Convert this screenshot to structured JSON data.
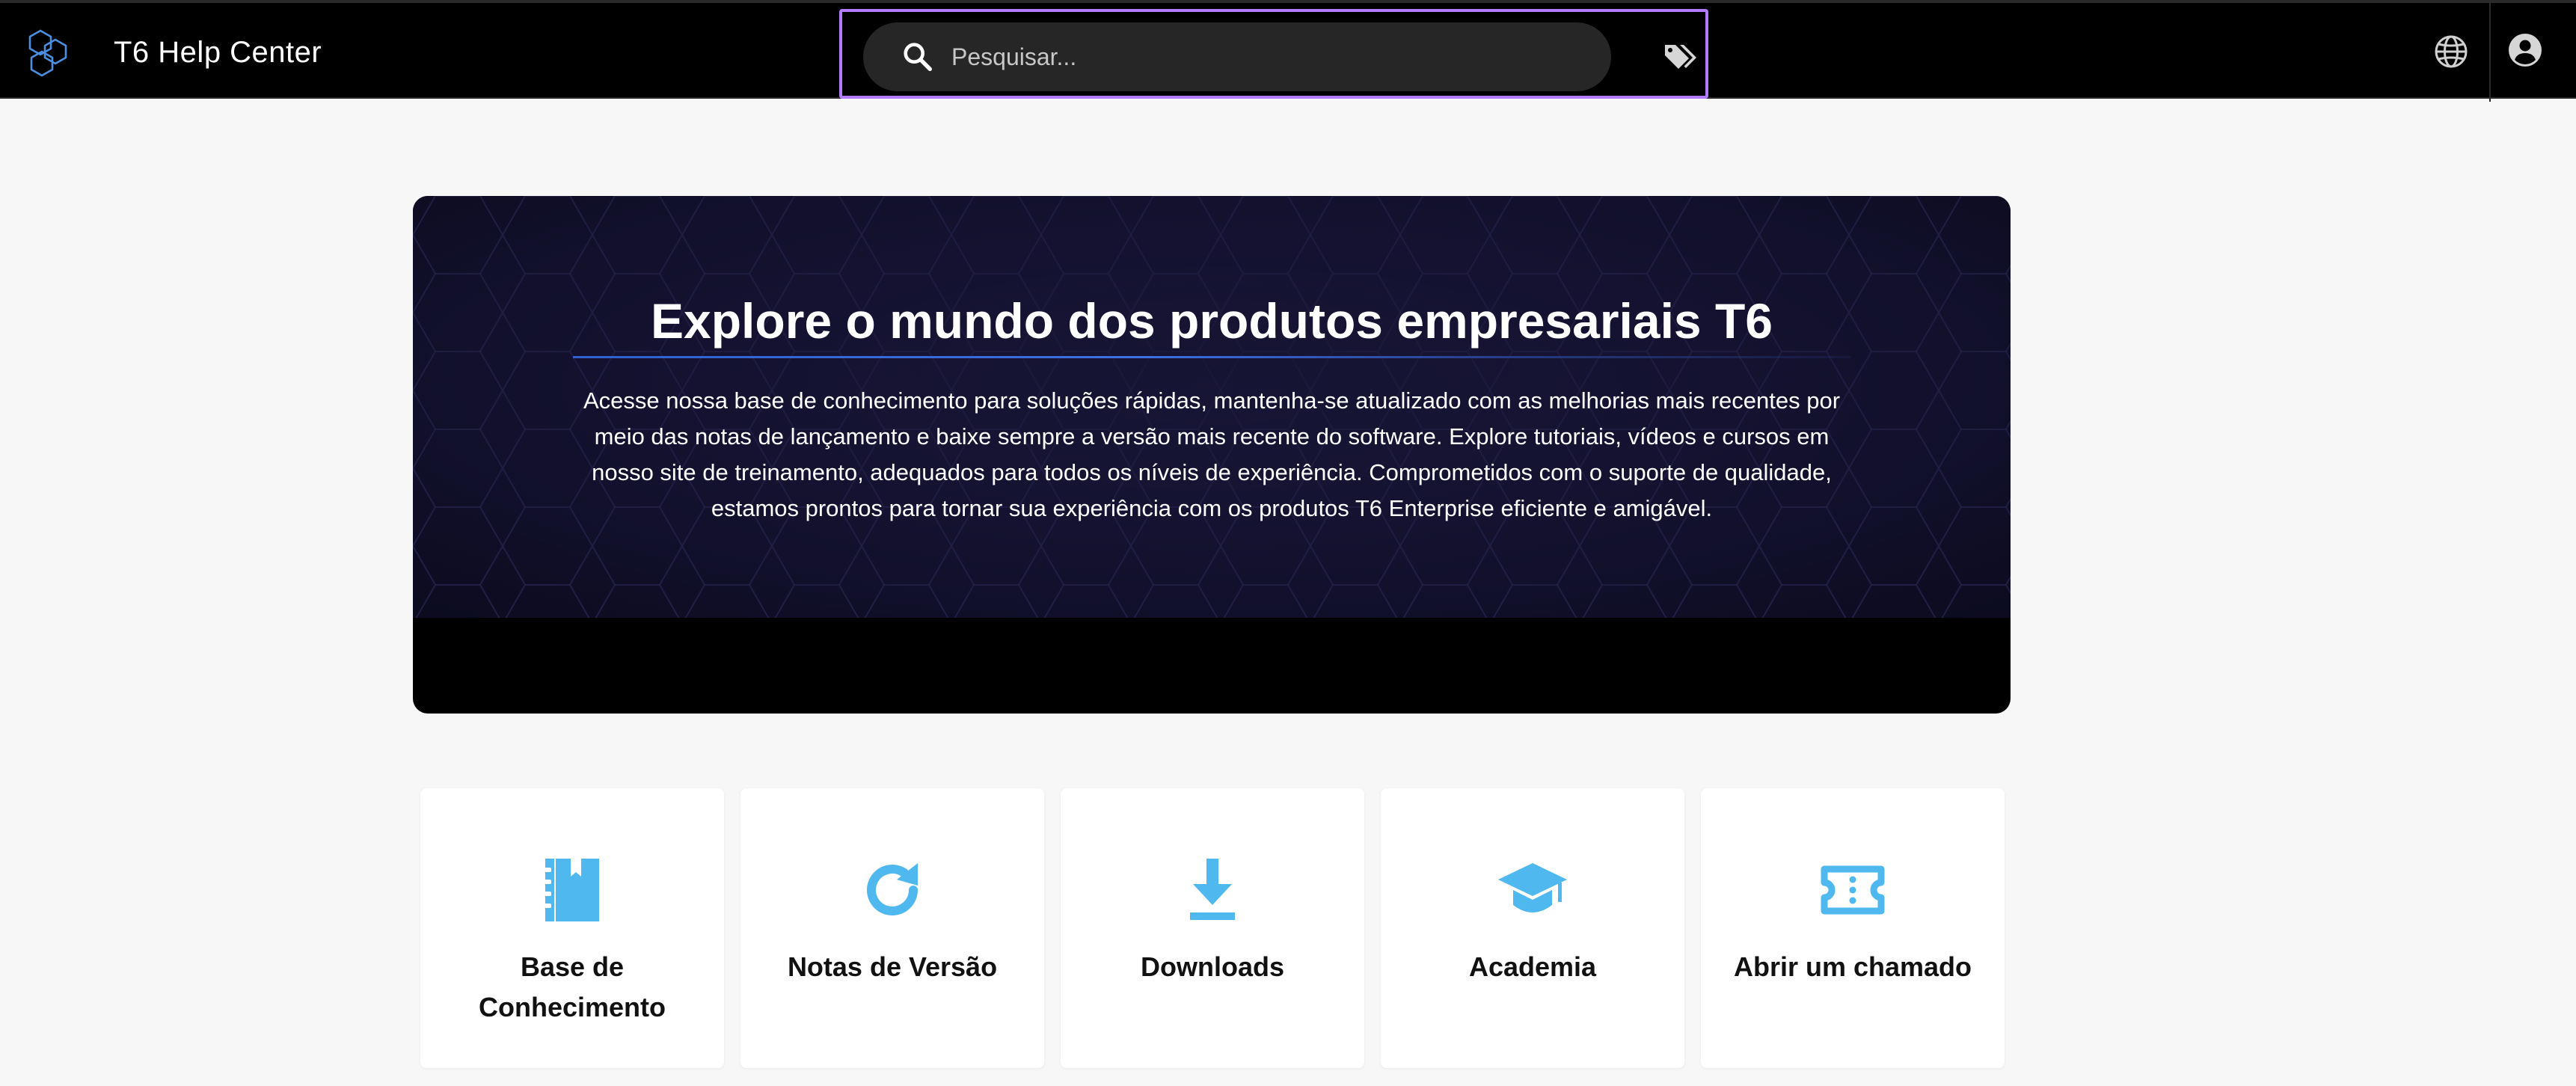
{
  "header": {
    "brand_name": "T6 Help Center",
    "search": {
      "placeholder": "Pesquisar...",
      "value": ""
    },
    "icons": [
      "brand-logo-icon",
      "search-icon",
      "tags-icon",
      "globe-icon",
      "account-icon"
    ]
  },
  "hero": {
    "title": "Explore o mundo dos produtos empresariais T6",
    "description": "Acesse nossa base de conhecimento para soluções rápidas, mantenha-se atualizado com as melhorias mais recentes por meio das notas de lançamento e baixe sempre a versão mais recente do software. Explore tutoriais, vídeos e cursos em nosso site de treinamento, adequados para todos os níveis de experiência. Comprometidos com o suporte de qualidade, estamos prontos para tornar sua experiência com os produtos T6 Enterprise eficiente e amigável."
  },
  "cards": [
    {
      "label": "Base de Conhecimento",
      "icon": "book-icon"
    },
    {
      "label": "Notas de Versão",
      "icon": "refresh-icon"
    },
    {
      "label": "Downloads",
      "icon": "download-icon"
    },
    {
      "label": "Academia",
      "icon": "graduation-cap-icon"
    },
    {
      "label": "Abrir um chamado",
      "icon": "ticket-icon"
    }
  ],
  "colors": {
    "header_bg": "#000000",
    "page_bg": "#f7f7f7",
    "search_focus": "#b57bff",
    "accent_icon": "#4fb8ee",
    "hero_bg": "#141230"
  }
}
